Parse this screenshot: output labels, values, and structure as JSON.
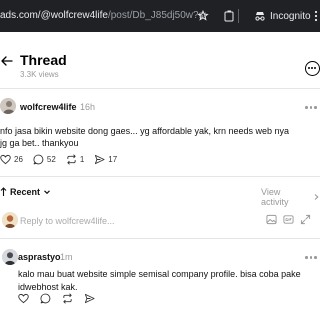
{
  "browser": {
    "url_host": "ads.com/@wolfcrew4life",
    "url_path": "/post/Db_J85dj50w?sort_or...",
    "incognito_label": "Incognito"
  },
  "header": {
    "title": "Thread",
    "views": "3.3K views"
  },
  "post": {
    "username": "wolfcrew4life",
    "timestamp": "16h",
    "text": "nfo jasa bikin website dong gaes... yg affordable yak, krn needs web nya jg ga bet.. thankyou",
    "likes": "26",
    "comments": "52",
    "reposts": "1",
    "shares": "17"
  },
  "recent": {
    "label": "Recent",
    "view_activity": "View activity"
  },
  "reply_box": {
    "placeholder": "Reply to wolfcrew4life..."
  },
  "comment": {
    "username": "asprastyo",
    "timestamp": "1m",
    "text": "kalo mau buat website simple semisal company profile. bisa coba pake idwebhost kak."
  }
}
